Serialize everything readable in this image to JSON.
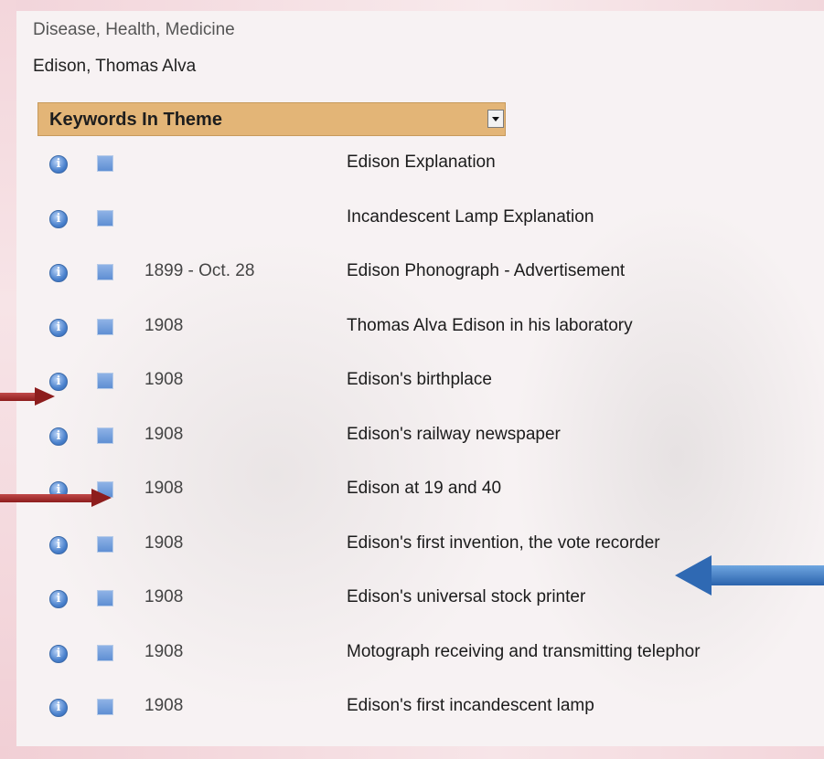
{
  "breadcrumbs": [
    "Disease, Health, Medicine",
    "Edison, Thomas Alva"
  ],
  "theme_select": {
    "selected": "Keywords In Theme"
  },
  "rows": [
    {
      "date": "",
      "title": "Edison Explanation"
    },
    {
      "date": "",
      "title": "Incandescent Lamp Explanation"
    },
    {
      "date": "1899 - Oct. 28",
      "title": "Edison Phonograph - Advertisement"
    },
    {
      "date": "1908",
      "title": "Thomas Alva Edison in his laboratory"
    },
    {
      "date": "1908",
      "title": "Edison's birthplace"
    },
    {
      "date": "1908",
      "title": "Edison's railway newspaper"
    },
    {
      "date": "1908",
      "title": "Edison at 19 and 40"
    },
    {
      "date": "1908",
      "title": "Edison's first invention, the vote recorder"
    },
    {
      "date": "1908",
      "title": "Edison's universal stock printer"
    },
    {
      "date": "1908",
      "title": "Motograph receiving and transmitting telephor"
    },
    {
      "date": "1908",
      "title": "Edison's first incandescent lamp"
    }
  ],
  "icons": {
    "info": "info-icon",
    "item": "item-square-icon",
    "select_arrow": "chevron-down-icon"
  },
  "colors": {
    "select_bg": "#e3b577",
    "info_blue": "#4b82cd",
    "arrow_red": "#8d1d1d",
    "arrow_blue": "#2b63ad"
  }
}
